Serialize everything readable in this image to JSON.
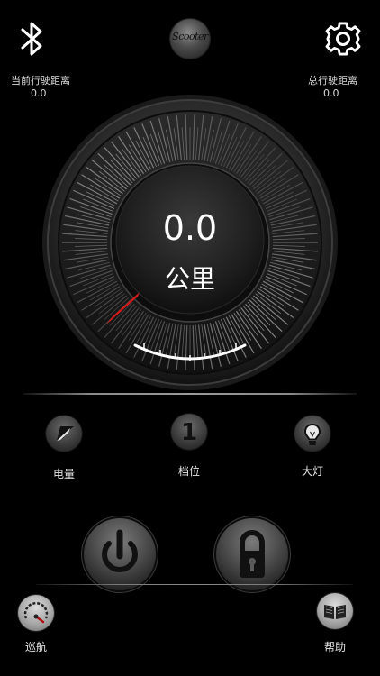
{
  "header": {
    "logo_text": "Scooter"
  },
  "stats": {
    "current_label": "当前行驶距离",
    "current_value": "0.0",
    "total_label": "总行驶距离",
    "total_value": "0.0"
  },
  "gauge": {
    "speed": "0.0",
    "unit": "公里"
  },
  "indicators": [
    {
      "label": "电量",
      "icon": "battery-icon"
    },
    {
      "label": "档位",
      "icon": "gear-number-icon",
      "glyph": "1"
    },
    {
      "label": "大灯",
      "icon": "bulb-icon"
    }
  ],
  "controls": {
    "power_icon": "power-icon",
    "lock_icon": "lock-icon"
  },
  "bottom": {
    "cruise_label": "巡航",
    "help_label": "帮助"
  },
  "colors": {
    "background": "#000000",
    "needle": "#d21a1a",
    "text": "#ffffff"
  }
}
